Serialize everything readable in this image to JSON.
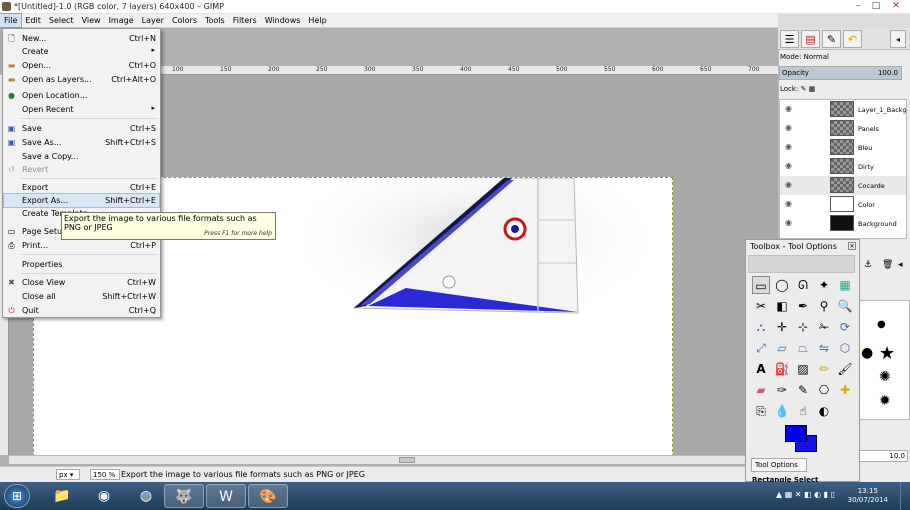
{
  "window": {
    "title": "*[Untitled]-1.0 (RGB color, 7 layers) 640x400 – GIMP",
    "controls": [
      "–",
      "□",
      "✕"
    ]
  },
  "menubar": [
    "File",
    "Edit",
    "Select",
    "View",
    "Image",
    "Layer",
    "Colors",
    "Tools",
    "Filters",
    "Windows",
    "Help"
  ],
  "file_menu": {
    "items": [
      {
        "label": "New...",
        "shortcut": "Ctrl+N",
        "icon": "new-file-icon"
      },
      {
        "label": "Create",
        "submenu": true
      },
      {
        "label": "Open...",
        "shortcut": "Ctrl+O",
        "icon": "open-folder-icon"
      },
      {
        "label": "Open as Layers...",
        "shortcut": "Ctrl+Alt+O",
        "icon": "open-layers-icon"
      },
      {
        "label": "Open Location...",
        "icon": "globe-icon"
      },
      {
        "label": "Open Recent",
        "submenu": true
      },
      {
        "label": "Save",
        "shortcut": "Ctrl+S",
        "icon": "save-icon"
      },
      {
        "label": "Save As...",
        "shortcut": "Shift+Ctrl+S",
        "icon": "save-as-icon"
      },
      {
        "label": "Save a Copy..."
      },
      {
        "label": "Revert",
        "disabled": true,
        "icon": "revert-icon"
      },
      {
        "label": "Export",
        "shortcut": "Ctrl+E"
      },
      {
        "label": "Export As...",
        "shortcut": "Shift+Ctrl+E",
        "highlighted": true
      },
      {
        "label": "Create Template..."
      },
      {
        "label": "Page Setup",
        "icon": "page-setup-icon"
      },
      {
        "label": "Print...",
        "shortcut": "Ctrl+P",
        "icon": "print-icon"
      },
      {
        "label": "Properties"
      },
      {
        "label": "Close View",
        "shortcut": "Ctrl+W",
        "icon": "close-icon"
      },
      {
        "label": "Close all",
        "shortcut": "Shift+Ctrl+W"
      },
      {
        "label": "Quit",
        "shortcut": "Ctrl+Q",
        "icon": "quit-icon"
      }
    ]
  },
  "tooltip": {
    "text": "Export the image to various file formats such as PNG or JPEG",
    "hint": "Press F1 for more help"
  },
  "ruler": {
    "ticks": [
      "100",
      "150",
      "200",
      "250",
      "300",
      "350",
      "400",
      "450",
      "500",
      "550",
      "600",
      "650",
      "700"
    ]
  },
  "statusbar": {
    "unit": "px",
    "zoom": "150 %",
    "message": "Export the image to various file formats such as PNG or JPEG"
  },
  "layers_panel": {
    "mode_label": "Mode: Normal",
    "opacity_label": "Opacity",
    "opacity_value": "100.0",
    "lock_label": "Lock:",
    "layers": [
      {
        "name": "Layer_1_Backgro",
        "thumb": "checker"
      },
      {
        "name": "Panels",
        "thumb": "checker"
      },
      {
        "name": "Bleu",
        "thumb": "checker"
      },
      {
        "name": "Dirty",
        "thumb": "checker"
      },
      {
        "name": "Cocarde",
        "thumb": "checker"
      },
      {
        "name": "Color",
        "thumb": "white"
      },
      {
        "name": "Background",
        "thumb": "dark"
      }
    ]
  },
  "toolbox": {
    "title": "Toolbox - Tool Options",
    "tool_options_tab": "Tool Options",
    "tool_name": "Rectangle Select",
    "fg_color": "#0000f0",
    "bg_color": "#1212ee"
  },
  "brushes": {
    "spacing": "10.0"
  },
  "taskbar": {
    "time": "13:15",
    "date": "30/07/2014",
    "apps": [
      "explorer-icon",
      "chrome-icon",
      "firefox-icon",
      "gimp-icon",
      "word-icon",
      "paint-icon"
    ]
  }
}
